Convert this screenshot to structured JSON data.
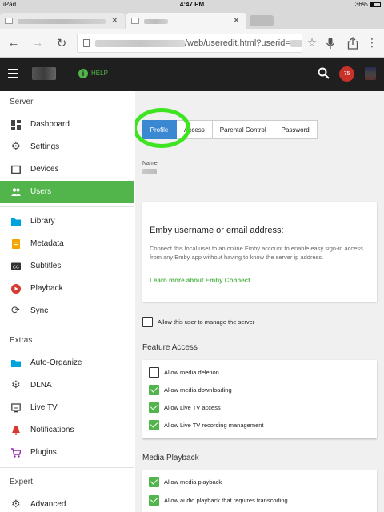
{
  "status_bar": {
    "device": "iPad",
    "time": "4:47 PM",
    "battery": "36%"
  },
  "browser": {
    "url_visible": "/web/useredit.html?userid="
  },
  "header": {
    "help_label": "HELP",
    "notification_count": "75"
  },
  "sidebar": {
    "sections": [
      {
        "title": "Server",
        "items": [
          {
            "label": "Dashboard",
            "icon": "dashboard-icon"
          },
          {
            "label": "Settings",
            "icon": "gear-icon"
          },
          {
            "label": "Devices",
            "icon": "devices-icon"
          },
          {
            "label": "Users",
            "icon": "users-icon",
            "active": true
          }
        ]
      },
      {
        "title": "",
        "items": [
          {
            "label": "Library",
            "icon": "folder-icon"
          },
          {
            "label": "Metadata",
            "icon": "metadata-icon"
          },
          {
            "label": "Subtitles",
            "icon": "subtitles-icon"
          },
          {
            "label": "Playback",
            "icon": "play-icon"
          },
          {
            "label": "Sync",
            "icon": "sync-icon"
          }
        ]
      },
      {
        "title": "Extras",
        "items": [
          {
            "label": "Auto-Organize",
            "icon": "folder-icon"
          },
          {
            "label": "DLNA",
            "icon": "gear-icon"
          },
          {
            "label": "Live TV",
            "icon": "tv-icon"
          },
          {
            "label": "Notifications",
            "icon": "bell-icon"
          },
          {
            "label": "Plugins",
            "icon": "cart-icon"
          }
        ]
      },
      {
        "title": "Expert",
        "items": [
          {
            "label": "Advanced",
            "icon": "gear-icon"
          }
        ]
      }
    ]
  },
  "colors": {
    "accent": "#52b54b",
    "selected_tab": "#3a88d1",
    "highlight_circle": "#3ee322",
    "header_bg": "#1f1f1f"
  },
  "tabs": [
    "Profile",
    "Access",
    "Parental Control",
    "Password"
  ],
  "profile": {
    "name_label": "Name:",
    "connect": {
      "field_label": "Emby username or email address:",
      "description": "Connect this local user to an online Emby account to enable easy sign-in access from any Emby app without having to know the server ip address.",
      "link": "Learn more about Emby Connect"
    },
    "manage_server": {
      "label": "Allow this user to manage the server",
      "checked": false
    },
    "feature_access": {
      "title": "Feature Access",
      "options": [
        {
          "label": "Allow media deletion",
          "checked": false
        },
        {
          "label": "Allow media downloading",
          "checked": true
        },
        {
          "label": "Allow Live TV access",
          "checked": true
        },
        {
          "label": "Allow Live TV recording management",
          "checked": true
        }
      ]
    },
    "media_playback": {
      "title": "Media Playback",
      "options": [
        {
          "label": "Allow media playback",
          "checked": true
        },
        {
          "label": "Allow audio playback that requires transcoding",
          "checked": true
        }
      ]
    }
  }
}
